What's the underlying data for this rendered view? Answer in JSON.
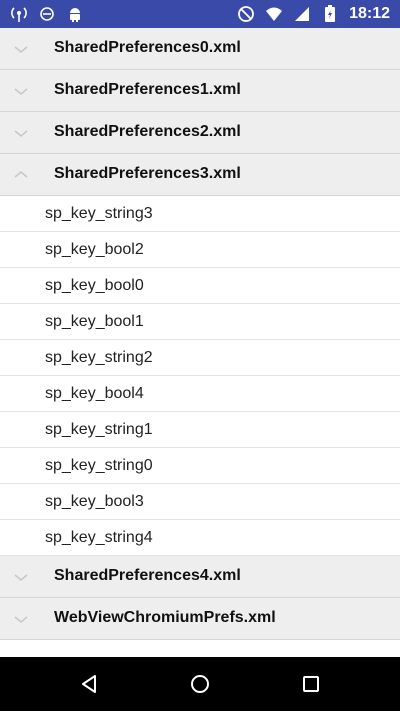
{
  "status_bar": {
    "time": "18:12",
    "left_icons": [
      "wifi-broadcast-icon",
      "hand-icon",
      "android-icon"
    ],
    "right_icons": [
      "no-disturb-icon",
      "wifi-icon",
      "signal-icon",
      "battery-charging-icon"
    ]
  },
  "groups": [
    {
      "title": "SharedPreferences0.xml",
      "expanded": false
    },
    {
      "title": "SharedPreferences1.xml",
      "expanded": false
    },
    {
      "title": "SharedPreferences2.xml",
      "expanded": false
    },
    {
      "title": "SharedPreferences3.xml",
      "expanded": true,
      "children": [
        "sp_key_string3",
        "sp_key_bool2",
        "sp_key_bool0",
        "sp_key_bool1",
        "sp_key_string2",
        "sp_key_bool4",
        "sp_key_string1",
        "sp_key_string0",
        "sp_key_bool3",
        "sp_key_string4"
      ]
    },
    {
      "title": "SharedPreferences4.xml",
      "expanded": false
    },
    {
      "title": "WebViewChromiumPrefs.xml",
      "expanded": false
    }
  ],
  "navigation_bar": {
    "buttons": [
      "back-icon",
      "home-icon",
      "recents-icon"
    ]
  },
  "colors": {
    "status_bar": "#3a4aa8",
    "header_bg": "#eeeeee",
    "nav_bar": "#000000"
  }
}
